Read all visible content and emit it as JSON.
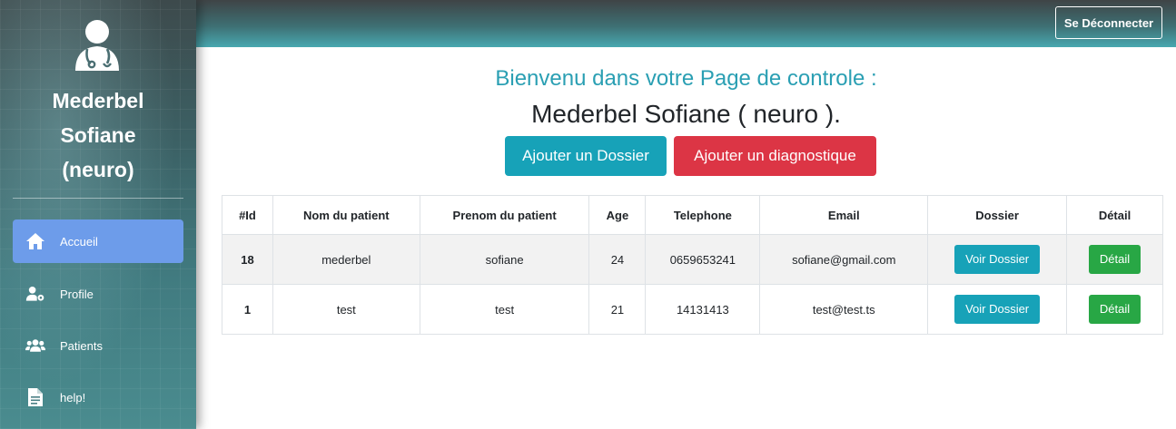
{
  "sidebar": {
    "doctor_name_lines": [
      "Mederbel",
      "Sofiane",
      "(neuro)"
    ],
    "items": [
      {
        "label": "Accueil",
        "icon": "home-icon",
        "active": true
      },
      {
        "label": "Profile",
        "icon": "user-gear-icon",
        "active": false
      },
      {
        "label": "Patients",
        "icon": "users-icon",
        "active": false
      },
      {
        "label": "help!",
        "icon": "file-icon",
        "active": false
      }
    ]
  },
  "topbar": {
    "logout_label": "Se Déconnecter"
  },
  "main": {
    "welcome": "Bienvenu dans votre Page de controle :",
    "doctor_title": "Mederbel Sofiane ( neuro ).",
    "add_dossier_label": "Ajouter un Dossier",
    "add_diagnostic_label": "Ajouter un diagnostique"
  },
  "table": {
    "headers": [
      "#Id",
      "Nom du patient",
      "Prenom du patient",
      "Age",
      "Telephone",
      "Email",
      "Dossier",
      "Détail"
    ],
    "rows": [
      {
        "id": "18",
        "nom": "mederbel",
        "prenom": "sofiane",
        "age": "24",
        "telephone": "0659653241",
        "email": "sofiane@gmail.com",
        "dossier_label": "Voir Dossier",
        "detail_label": "Détail"
      },
      {
        "id": "1",
        "nom": "test",
        "prenom": "test",
        "age": "21",
        "telephone": "14131413",
        "email": "test@test.ts",
        "dossier_label": "Voir Dossier",
        "detail_label": "Détail"
      }
    ]
  },
  "colors": {
    "accent": "#17a2b8",
    "danger": "#dc3545",
    "success": "#28a745",
    "active_nav": "#6d9cea",
    "welcome_text": "#2a9fb3"
  }
}
